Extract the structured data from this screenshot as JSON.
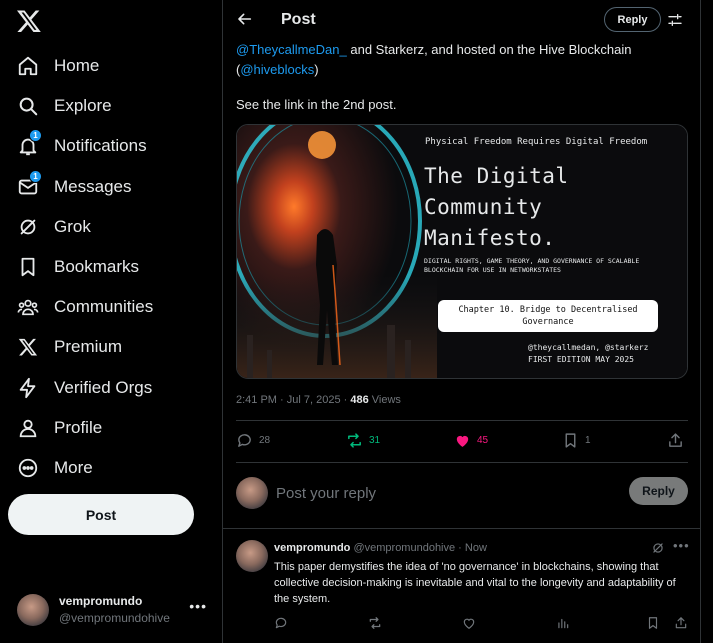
{
  "sidebar": {
    "logo": "x-logo-icon",
    "items": [
      {
        "label": "Home",
        "icon": "home-icon"
      },
      {
        "label": "Explore",
        "icon": "search-icon"
      },
      {
        "label": "Notifications",
        "icon": "bell-icon",
        "badge": "1"
      },
      {
        "label": "Messages",
        "icon": "mail-icon",
        "badge": "1"
      },
      {
        "label": "Grok",
        "icon": "grok-icon"
      },
      {
        "label": "Bookmarks",
        "icon": "bookmark-icon"
      },
      {
        "label": "Communities",
        "icon": "communities-icon"
      },
      {
        "label": "Premium",
        "icon": "x-premium-icon"
      },
      {
        "label": "Verified Orgs",
        "icon": "lightning-icon"
      },
      {
        "label": "Profile",
        "icon": "person-icon"
      },
      {
        "label": "More",
        "icon": "more-circle-icon"
      }
    ],
    "post_button": "Post",
    "account": {
      "name": "vempromundo",
      "handle": "@vempromundohive"
    }
  },
  "header": {
    "title": "Post",
    "reply_button": "Reply"
  },
  "post": {
    "mention1": "@TheycallmeDan_",
    "text_mid": " and Starkerz, and hosted on the Hive Blockchain (",
    "mention2": "@hiveblocks",
    "text_end": ")",
    "line2": "See the link in the 2nd post.",
    "media": {
      "kicker": "Physical Freedom Requires Digital Freedom",
      "title": "The Digital\nCommunity\nManifesto.",
      "subtitle": "DIGITAL RIGHTS, GAME THEORY, AND GOVERNANCE OF SCALABLE\nBLOCKCHAIN FOR USE IN NETWORKSTATES",
      "chapter": "Chapter 10. Bridge to Decentralised\nGovernance",
      "handles": "@theycallmedan, @starkerz",
      "edition": "FIRST EDITION MAY 2025"
    },
    "time": "2:41 PM · Jul 7, 2025 · ",
    "views_count": "486",
    "views_label": " Views",
    "stats": {
      "replies": "28",
      "reposts": "31",
      "likes": "45",
      "bookmarks": "1"
    },
    "colors": {
      "repost": "#00ba7c",
      "like": "#f91880",
      "accent": "#1d9bf0"
    }
  },
  "reply_box": {
    "placeholder": "Post your reply",
    "button": "Reply"
  },
  "reply": {
    "name": "vempromundo",
    "handle": " @vempromundohive · Now",
    "text": "This paper demystifies the idea of 'no governance' in blockchains, showing that collective decision-making is inevitable and vital to the longevity and adaptability of the system."
  }
}
